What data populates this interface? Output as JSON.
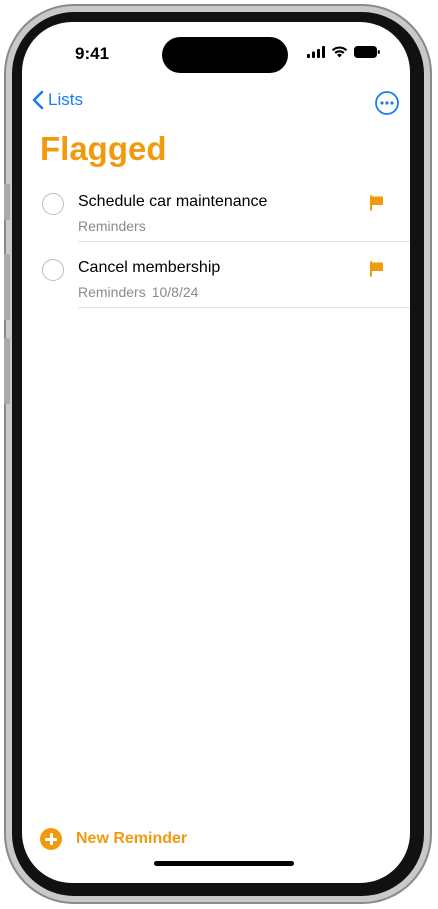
{
  "status_bar": {
    "time": "9:41"
  },
  "nav": {
    "back_label": "Lists",
    "more_icon": "ellipsis-circle-icon"
  },
  "list": {
    "title": "Flagged",
    "accent_color": "#f29a0e",
    "items": [
      {
        "title": "Schedule car maintenance",
        "list_name": "Reminders",
        "date": "",
        "flagged": true
      },
      {
        "title": "Cancel membership",
        "list_name": "Reminders",
        "date": "10/8/24",
        "flagged": true
      }
    ]
  },
  "footer": {
    "new_reminder_label": "New Reminder"
  }
}
